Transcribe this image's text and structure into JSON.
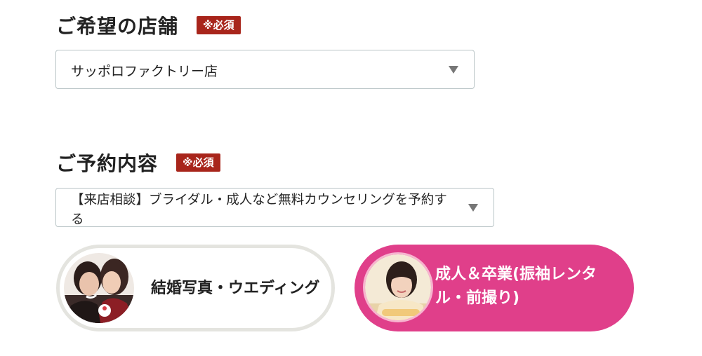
{
  "store": {
    "title": "ご希望の店舗",
    "required": "※必須",
    "selected": "サッポロファクトリー店"
  },
  "reservation": {
    "title": "ご予約内容",
    "required": "※必須",
    "selected_line1": "【来店相談】ブライダル・成人など無料カウンセリングを予約す",
    "selected_line2": "る"
  },
  "categories": [
    {
      "label": "結婚写真・ウエディング",
      "active": false
    },
    {
      "label_line1": "成人＆卒業(振袖レンタ",
      "label_line2": "ル・前撮り)",
      "active": true
    }
  ],
  "colors": {
    "badge": "#a8251b",
    "active_pill": "#e03f8a",
    "inactive_pill_border": "#e4e4df"
  }
}
